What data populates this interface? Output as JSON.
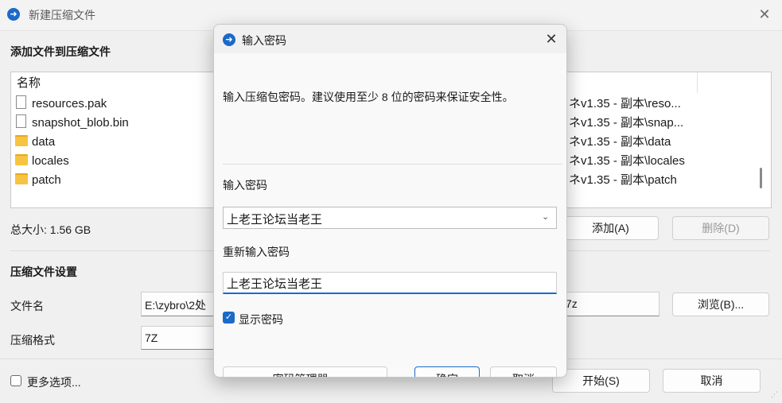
{
  "window": {
    "title": "新建压缩文件",
    "close_glyph": "✕"
  },
  "files_section": {
    "title": "添加文件到压缩文件",
    "column_name": "名称",
    "items": [
      {
        "name": "resources.pak",
        "type": "file",
        "path": "ネv1.35 - 副本\\reso..."
      },
      {
        "name": "snapshot_blob.bin",
        "type": "file",
        "path": "ネv1.35 - 副本\\snap..."
      },
      {
        "name": "data",
        "type": "folder",
        "path": "ネv1.35 - 副本\\data"
      },
      {
        "name": "locales",
        "type": "folder",
        "path": "ネv1.35 - 副本\\locales"
      },
      {
        "name": "patch",
        "type": "folder",
        "path": "ネv1.35 - 副本\\patch"
      }
    ],
    "total_size": "总大小: 1.56 GB",
    "add_button": "添加(A)",
    "delete_button": "删除(D)"
  },
  "settings": {
    "title": "压缩文件设置",
    "filename_label": "文件名",
    "filename_value": "E:\\zybro\\2处",
    "filename_ext": "7z",
    "browse_button": "浏览(B)...",
    "format_label": "压缩格式",
    "format_value": "7Z"
  },
  "footer": {
    "more_options": "更多选项...",
    "start_button": "开始(S)",
    "cancel_button": "取消"
  },
  "dialog": {
    "title": "输入密码",
    "description": "输入压缩包密码。建议使用至少 8 位的密码来保证安全性。",
    "password_label": "输入密码",
    "password_value": "上老王论坛当老王",
    "reenter_label": "重新输入密码",
    "reenter_value": "上老王论坛当老王",
    "show_password_label": "显示密码",
    "show_password_checked": true,
    "manager_button": "密码管理器...",
    "ok_button": "确定",
    "cancel_button": "取消"
  },
  "colors": {
    "accent": "#1b6ac9",
    "folder": "#f6c343"
  }
}
